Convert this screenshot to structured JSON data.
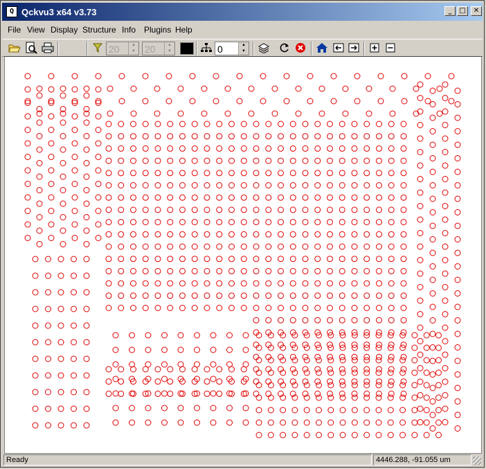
{
  "window": {
    "title": "Qckvu3 x64 v3.73",
    "app_icon": "q-icon",
    "buttons": [
      "minimize",
      "maximize",
      "close"
    ],
    "minimize_glyph": "_",
    "maximize_glyph": "□",
    "close_glyph": "✕"
  },
  "menu": {
    "items": [
      "File",
      "View",
      "Display",
      "Structure",
      "Info",
      "Plugins",
      "Help"
    ]
  },
  "toolbar": {
    "icons": [
      "open-folder-icon",
      "print-preview-icon",
      "print-icon",
      "filter-icon",
      "hierarchy-icon",
      "layers-icon",
      "refresh-icon",
      "stop-icon",
      "home-icon",
      "arrow-left-icon",
      "arrow-right-icon",
      "plus-icon",
      "minus-icon"
    ],
    "spin1_value": "20",
    "spin2_value": "20",
    "depth_value": "0",
    "color_swatch": "#000000"
  },
  "canvas": {
    "background": "#ffffff",
    "marker_color": "#e00000",
    "marker_shape": "circle-outline"
  },
  "status": {
    "left": "Ready",
    "right": "4446.288, -91.055 um"
  }
}
